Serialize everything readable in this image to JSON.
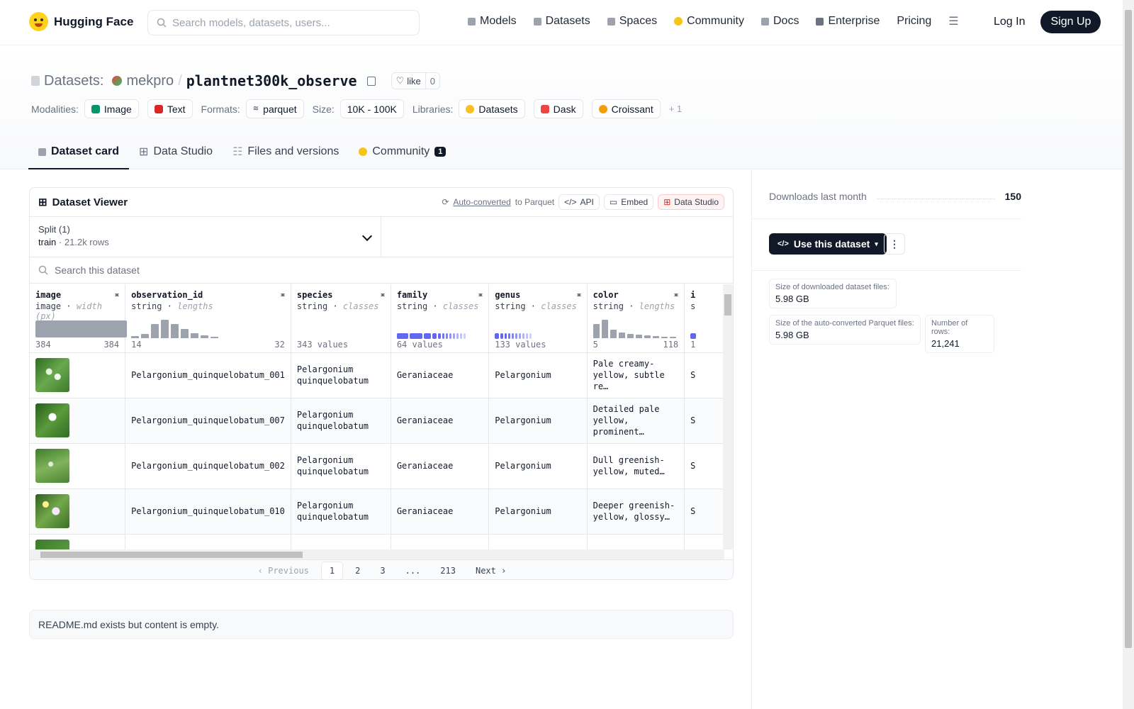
{
  "nav": {
    "brand": "Hugging Face",
    "search_placeholder": "Search models, datasets, users...",
    "links": [
      "Models",
      "Datasets",
      "Spaces",
      "Community",
      "Docs",
      "Enterprise",
      "Pricing"
    ],
    "login": "Log In",
    "signup": "Sign Up"
  },
  "header": {
    "section": "Datasets:",
    "owner": "mekpro",
    "slash": "/",
    "repo": "plantnet300k_observe",
    "like_label": "like",
    "like_count": "0",
    "modalities_label": "Modalities:",
    "modalities": [
      "Image",
      "Text"
    ],
    "formats_label": "Formats:",
    "formats": [
      "parquet"
    ],
    "size_label": "Size:",
    "size": "10K - 100K",
    "libraries_label": "Libraries:",
    "libraries": [
      "Datasets",
      "Dask",
      "Croissant"
    ],
    "more_libraries": "+ 1"
  },
  "tabs": [
    {
      "label": "Dataset card",
      "active": true
    },
    {
      "label": "Data Studio"
    },
    {
      "label": "Files and versions"
    },
    {
      "label": "Community",
      "badge": "1"
    }
  ],
  "viewer": {
    "title": "Dataset Viewer",
    "auto_converted": "Auto-converted",
    "to_parquet": "to Parquet",
    "api": "API",
    "embed": "Embed",
    "data_studio": "Data Studio",
    "split_label": "Split (1)",
    "split_value": "train",
    "split_sep": "·",
    "split_rows": "21.2k rows",
    "search_placeholder": "Search this dataset",
    "columns": [
      {
        "name": "image",
        "type": "image",
        "sub": "width (px)",
        "min": "384",
        "max": "384"
      },
      {
        "name": "observation_id",
        "type": "string",
        "sub": "lengths",
        "min": "14",
        "max": "32"
      },
      {
        "name": "species",
        "type": "string",
        "sub": "classes",
        "min": "343 values",
        "max": ""
      },
      {
        "name": "family",
        "type": "string",
        "sub": "classes",
        "min": "64 values",
        "max": ""
      },
      {
        "name": "genus",
        "type": "string",
        "sub": "classes",
        "min": "133 values",
        "max": ""
      },
      {
        "name": "color",
        "type": "string",
        "sub": "lengths",
        "min": "5",
        "max": "118"
      },
      {
        "name": "i",
        "type": "s",
        "sub": "",
        "min": "1",
        "max": ""
      }
    ],
    "rows": [
      [
        "",
        "Pelargonium_quinquelobatum_001",
        "Pelargonium quinquelobatum",
        "Geraniaceae",
        "Pelargonium",
        "Pale creamy-yellow, subtle re…",
        "S"
      ],
      [
        "",
        "Pelargonium_quinquelobatum_007",
        "Pelargonium quinquelobatum",
        "Geraniaceae",
        "Pelargonium",
        "Detailed pale yellow, prominent…",
        "S"
      ],
      [
        "",
        "Pelargonium_quinquelobatum_002",
        "Pelargonium quinquelobatum",
        "Geraniaceae",
        "Pelargonium",
        "Dull greenish-yellow, muted…",
        "S"
      ],
      [
        "",
        "Pelargonium_quinquelobatum_010",
        "Pelargonium quinquelobatum",
        "Geraniaceae",
        "Pelargonium",
        "Deeper greenish-yellow, glossy…",
        "S"
      ]
    ],
    "pager": {
      "prev": "Previous",
      "pages": [
        "1",
        "2",
        "3",
        "...",
        "213"
      ],
      "next": "Next"
    }
  },
  "readme": "README.md exists but content is empty.",
  "sidebar": {
    "downloads_label": "Downloads last month",
    "downloads": "150",
    "use_button": "Use this dataset",
    "kebab": "⋮",
    "cards": [
      {
        "k": "Size of downloaded dataset files:",
        "v": "5.98 GB"
      },
      {
        "k": "Size of the auto-converted Parquet files:",
        "v": "5.98 GB"
      },
      {
        "k": "Number of rows:",
        "v": "21,241"
      }
    ]
  },
  "colors": {
    "accent": "#111827",
    "class_bar": "#6366f1",
    "hist_bar": "#9ca3af"
  },
  "icons": [
    "hugging-face-logo",
    "search-icon",
    "menu-icon",
    "copy-icon",
    "heart-icon",
    "table-icon",
    "chevron-down-icon",
    "code-icon",
    "refresh-icon"
  ]
}
